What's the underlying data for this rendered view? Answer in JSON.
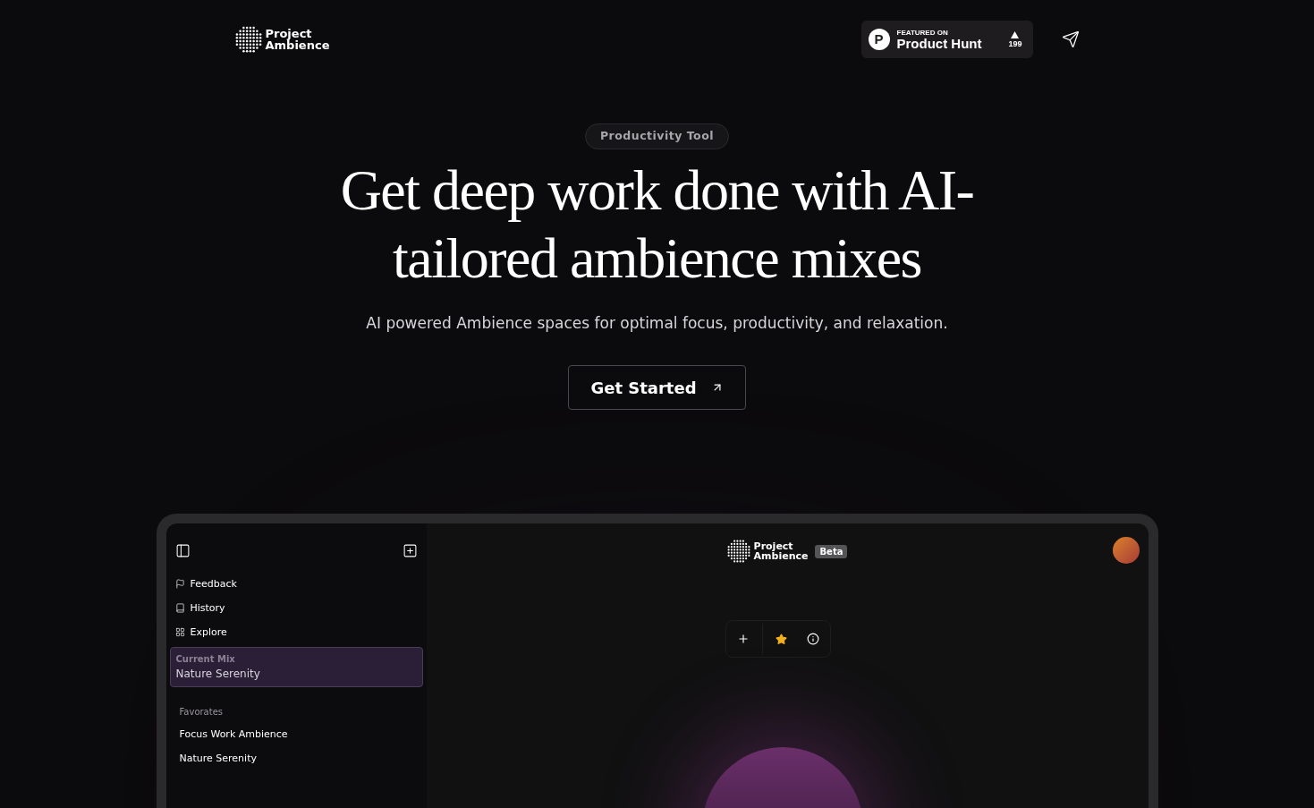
{
  "header": {
    "logo": [
      "Project",
      "Ambience"
    ],
    "badge": {
      "mark": "P",
      "kicker": "FEATURED ON",
      "name": "Product Hunt",
      "votes": "199"
    }
  },
  "hero": {
    "tag": "Productivity Tool",
    "headline": "Get deep work done with AI-tailored ambience mixes",
    "subtitle": "AI powered Ambience spaces for optimal focus, productivity, and relaxation.",
    "cta": "Get Started"
  },
  "app": {
    "sidebar": {
      "nav": [
        {
          "kind": "flag",
          "label": "Feedback"
        },
        {
          "kind": "book",
          "label": "History"
        },
        {
          "kind": "grid",
          "label": "Explore"
        }
      ],
      "current_mix": {
        "label": "Current Mix",
        "value": "Nature Serenity"
      },
      "favorites_title": "Favorates",
      "favorites": [
        "Focus Work Ambience",
        "Nature Serenity"
      ]
    },
    "logo": [
      "Project",
      "Ambience"
    ],
    "beta": "Beta",
    "favorited": true
  }
}
